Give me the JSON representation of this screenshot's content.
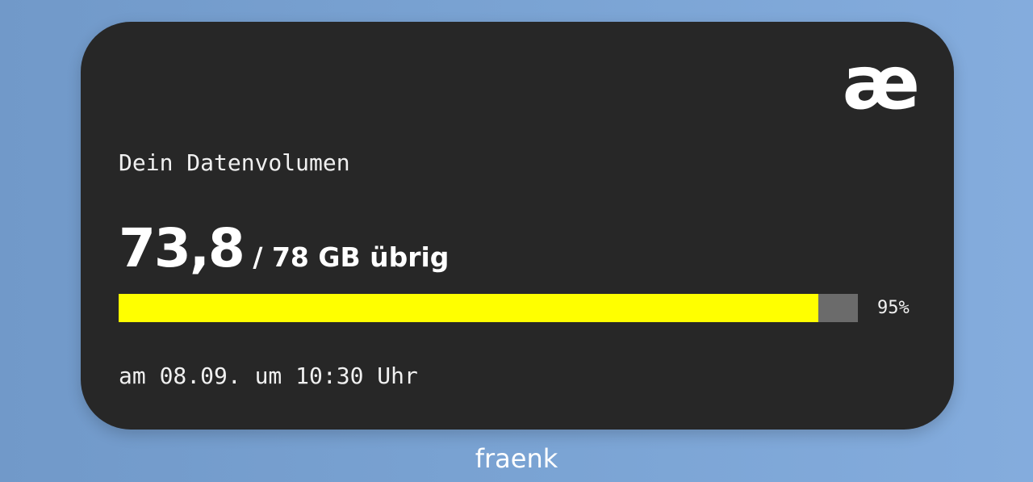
{
  "widget": {
    "logo_text": "æ",
    "title": "Dein Datenvolumen",
    "remaining_value": "73,8",
    "remaining_suffix": "/ 78 GB übrig",
    "progress": {
      "fraction": 0.946,
      "percent_label": "95%",
      "fill_color": "#ffff00",
      "track_color": "#6b6b6b"
    },
    "timestamp": "am 08.09. um 10:30 Uhr"
  },
  "app_label": "fraenk"
}
